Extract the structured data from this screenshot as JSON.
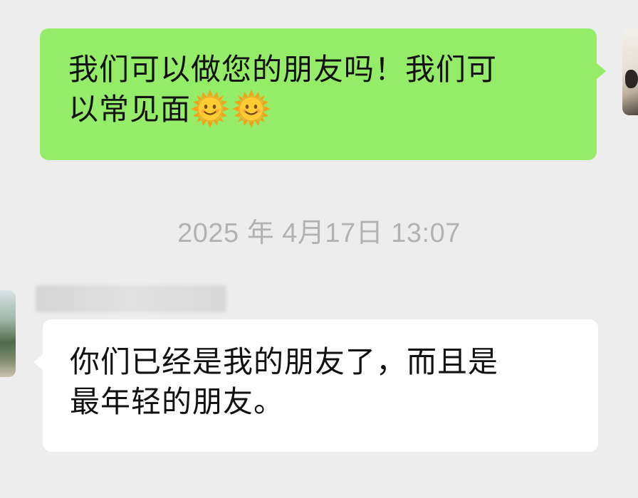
{
  "chat": {
    "messages": [
      {
        "direction": "outgoing",
        "text": "我们可以做您的朋友吗！我们可\n以常见面",
        "emojis": [
          "sun-with-face-icon",
          "sun-with-face-icon"
        ]
      },
      {
        "direction": "incoming",
        "text": "你们已经是我的朋友了，而且是\n最年轻的朋友。"
      }
    ],
    "timestamp": "2025 年 4月17日 13:07"
  },
  "colors": {
    "background": "#ededed",
    "outgoing_bubble": "#95ec69",
    "incoming_bubble": "#ffffff",
    "timestamp_text": "#b2b2b2",
    "message_text": "#111111"
  }
}
